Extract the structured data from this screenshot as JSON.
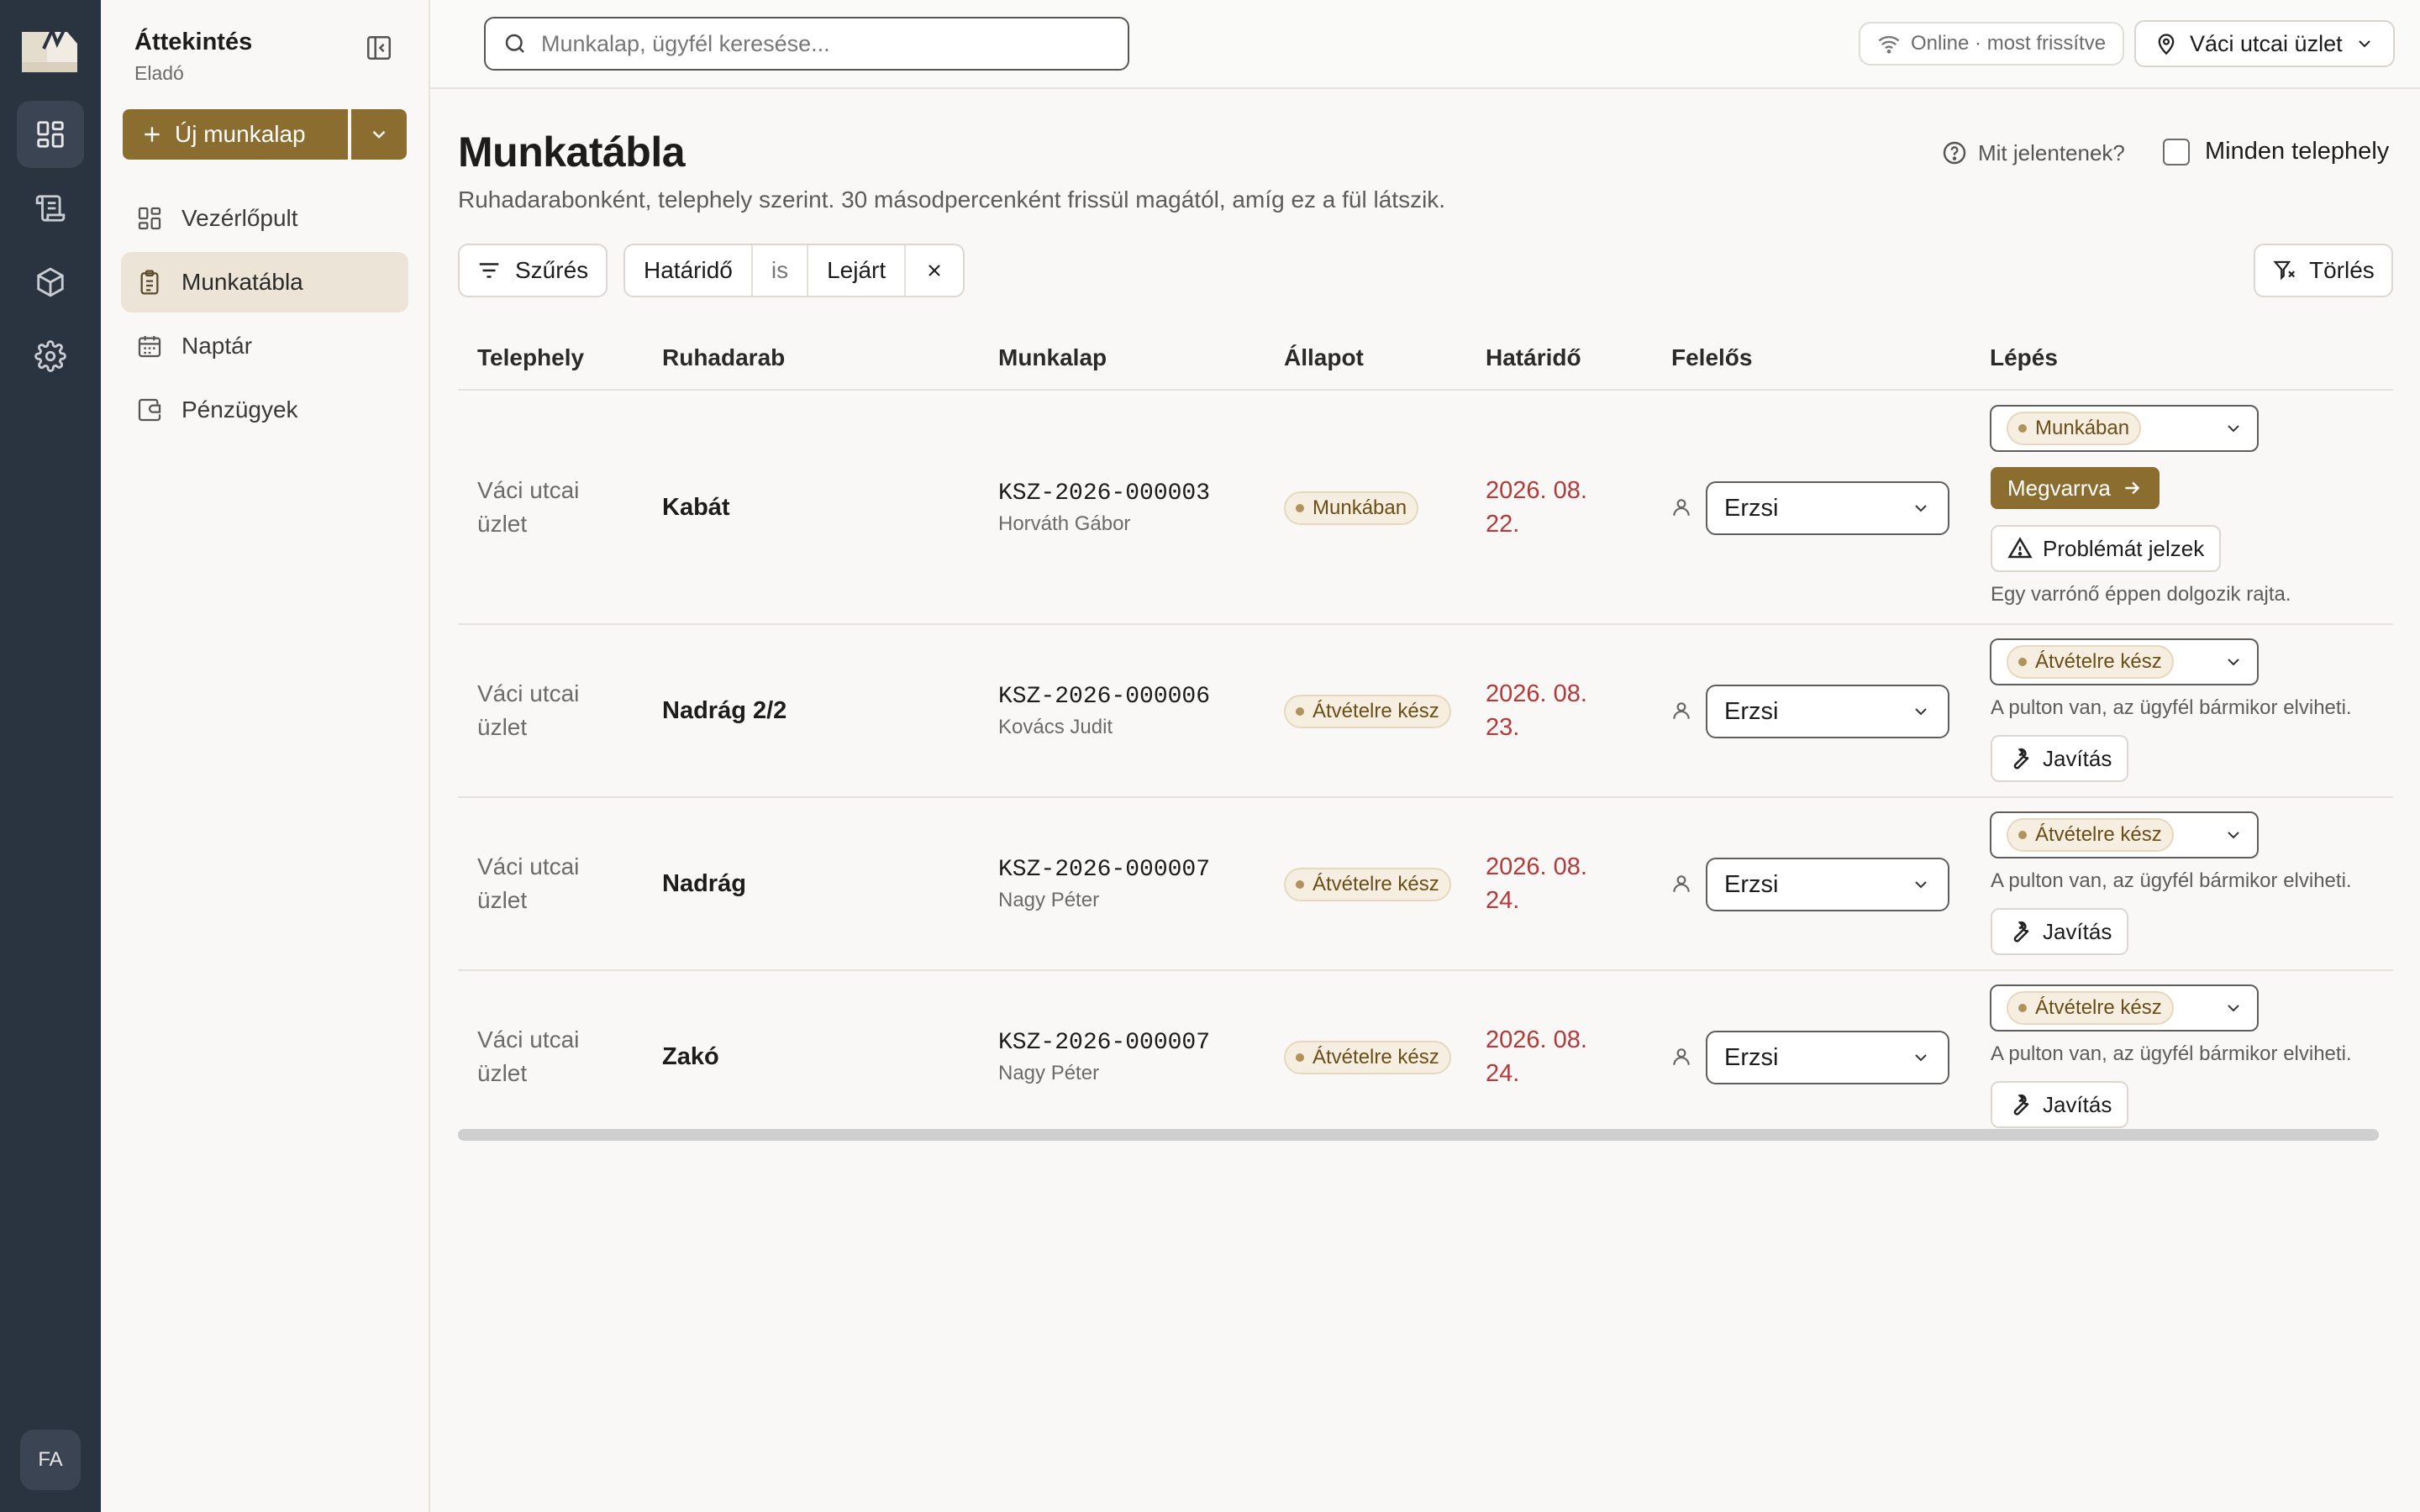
{
  "sidebar": {
    "title": "Áttekintés",
    "role": "Eladó",
    "new_button": "Új munkalap",
    "items": [
      {
        "label": "Vezérlőpult",
        "icon": "dashboard-icon"
      },
      {
        "label": "Munkatábla",
        "icon": "clipboard-icon",
        "active": true
      },
      {
        "label": "Naptár",
        "icon": "calendar-icon"
      },
      {
        "label": "Pénzügyek",
        "icon": "wallet-icon"
      }
    ],
    "user_initials": "FA"
  },
  "topbar": {
    "search_placeholder": "Munkalap, ügyfél keresése...",
    "status": "Online · most frissítve",
    "store": "Váci utcai üzlet"
  },
  "page": {
    "title": "Munkatábla",
    "subtitle": "Ruhadarabonként, telephely szerint. 30 másodpercenként frissül magától, amíg ez a fül látszik.",
    "legend_link": "Mit jelentenek?",
    "all_sites_label": "Minden telephely",
    "all_sites_checked": false
  },
  "filters": {
    "filter_button": "Szűrés",
    "chip": {
      "field": "Határidő",
      "operator": "is",
      "value": "Lejárt"
    },
    "clear_button": "Törlés"
  },
  "table": {
    "columns": [
      "Telephely",
      "Ruhadarab",
      "Munkalap",
      "Állapot",
      "Határidő",
      "Felelős",
      "Lépés"
    ],
    "rows": [
      {
        "site": "Váci utcai üzlet",
        "item": "Kabát",
        "worksheet": "KSZ-2026-000003",
        "customer": "Horváth Gábor",
        "status": "Munkában",
        "deadline": "2026. 08. 22.",
        "assignee": "Erzsi",
        "step_status": "Munkában",
        "primary_action": "Megvarrva",
        "secondary_action": "Problémát jelzek",
        "note": "Egy varrónő éppen dolgozik rajta."
      },
      {
        "site": "Váci utcai üzlet",
        "item": "Nadrág 2/2",
        "worksheet": "KSZ-2026-000006",
        "customer": "Kovács Judit",
        "status": "Átvételre kész",
        "deadline": "2026. 08. 23.",
        "assignee": "Erzsi",
        "step_status": "Átvételre kész",
        "note": "A pulton van, az ügyfél bármikor elviheti.",
        "secondary_action": "Javítás"
      },
      {
        "site": "Váci utcai üzlet",
        "item": "Nadrág",
        "worksheet": "KSZ-2026-000007",
        "customer": "Nagy Péter",
        "status": "Átvételre kész",
        "deadline": "2026. 08. 24.",
        "assignee": "Erzsi",
        "step_status": "Átvételre kész",
        "note": "A pulton van, az ügyfél bármikor elviheti.",
        "secondary_action": "Javítás"
      },
      {
        "site": "Váci utcai üzlet",
        "item": "Zakó",
        "worksheet": "KSZ-2026-000007",
        "customer": "Nagy Péter",
        "status": "Átvételre kész",
        "deadline": "2026. 08. 24.",
        "assignee": "Erzsi",
        "step_status": "Átvételre kész",
        "note": "A pulton van, az ügyfél bármikor elviheti.",
        "secondary_action": "Javítás"
      }
    ]
  },
  "colors": {
    "accent": "#8b6d2f",
    "rail": "#2a3340",
    "deadline": "#b23a3a",
    "badge_bg": "#f6efe1"
  }
}
